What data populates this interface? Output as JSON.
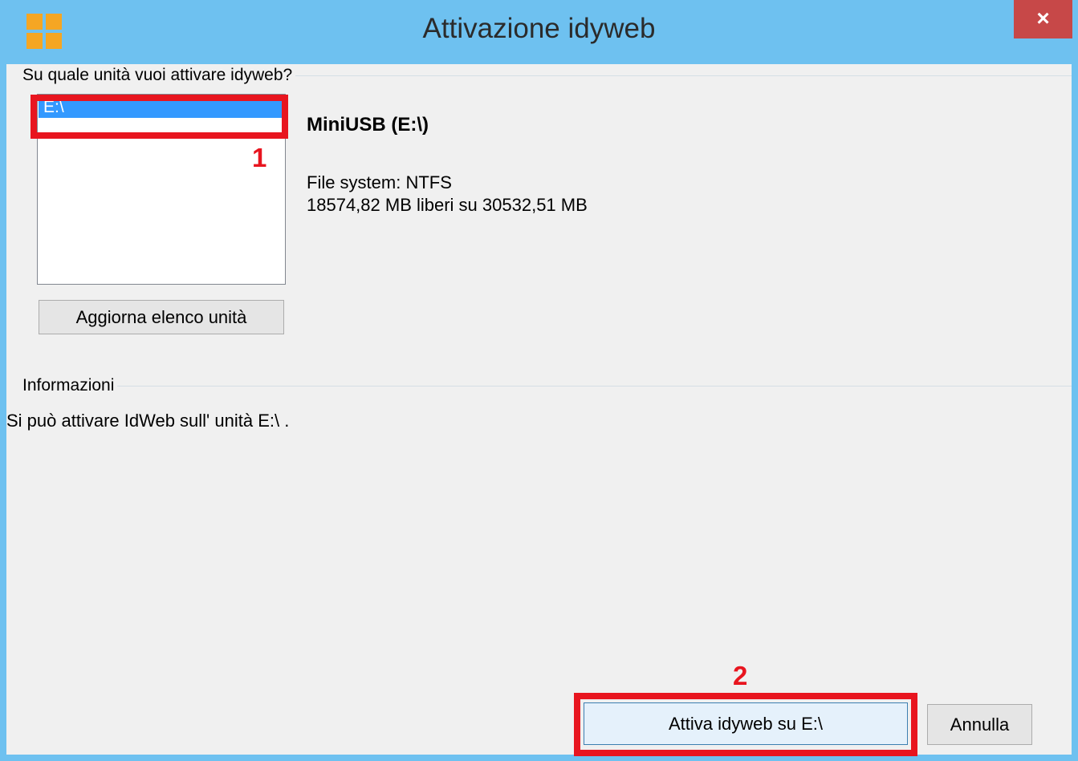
{
  "window": {
    "title": "Attivazione idyweb",
    "close_label": "×"
  },
  "drive_group": {
    "legend": "Su quale unità vuoi attivare idyweb?",
    "drives": [
      "E:\\"
    ],
    "selected_index": 0,
    "refresh_button": "Aggiorna elenco unità"
  },
  "drive_details": {
    "name": "MiniUSB (E:\\)",
    "filesystem": "File system: NTFS",
    "space": "18574,82 MB liberi su 30532,51 MB"
  },
  "info_group": {
    "legend": "Informazioni",
    "message": "Si può attivare IdWeb sull' unità E:\\ ."
  },
  "buttons": {
    "activate": "Attiva idyweb su E:\\",
    "cancel": "Annulla"
  },
  "annotations": {
    "step1": "1",
    "step2": "2"
  },
  "colors": {
    "titlebar": "#6ec1f0",
    "selection": "#3399ff",
    "annotation": "#e8151f",
    "close": "#c74848"
  }
}
